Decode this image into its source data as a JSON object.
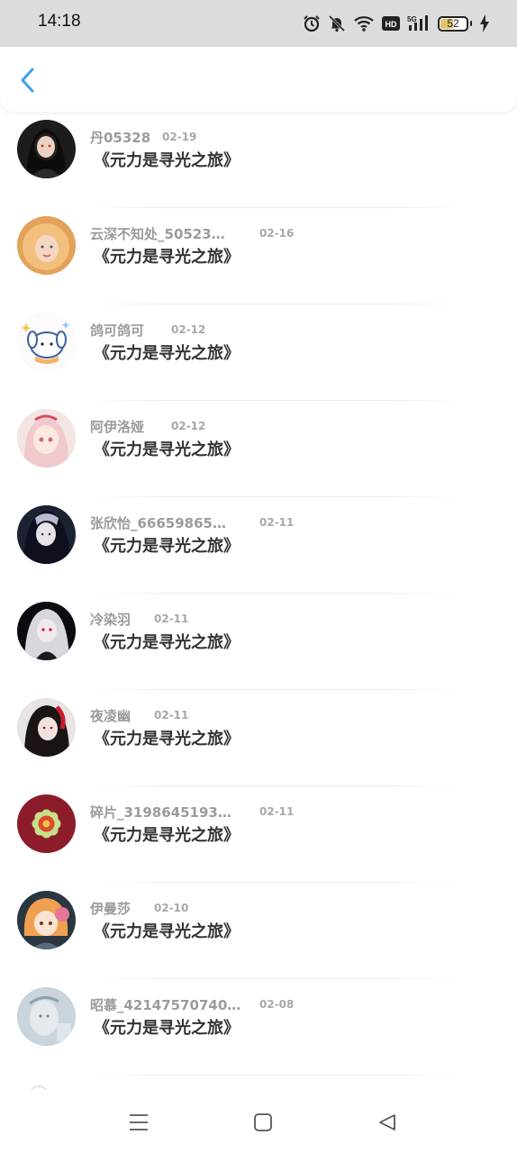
{
  "status_bar": {
    "time": "14:18",
    "battery": "52",
    "battery_level": 0.52,
    "icons": [
      "alarm-icon",
      "mute-icon",
      "wifi-icon",
      "hd-icon",
      "signal-5g-icon",
      "battery-icon",
      "charging-icon"
    ],
    "hd_label": "HD",
    "network_label": "5G"
  },
  "header": {
    "back_icon": "chevron-left-icon",
    "accent": "#3aa0e6"
  },
  "list": {
    "items": [
      {
        "name": "丹05328",
        "date": "02-19",
        "title": "《元力是寻光之旅》"
      },
      {
        "name": "云深不知处_50523…",
        "date": "02-16",
        "title": "《元力是寻光之旅》"
      },
      {
        "name": "鸽可鸽可",
        "date": "02-12",
        "title": "《元力是寻光之旅》"
      },
      {
        "name": "阿伊洛娅",
        "date": "02-12",
        "title": "《元力是寻光之旅》"
      },
      {
        "name": "张欣怡_66659865…",
        "date": "02-11",
        "title": "《元力是寻光之旅》"
      },
      {
        "name": "冷染羽",
        "date": "02-11",
        "title": "《元力是寻光之旅》"
      },
      {
        "name": "夜凌幽",
        "date": "02-11",
        "title": "《元力是寻光之旅》"
      },
      {
        "name": "碎片_3198645193…",
        "date": "02-11",
        "title": "《元力是寻光之旅》"
      },
      {
        "name": "伊曼莎",
        "date": "02-10",
        "title": "《元力是寻光之旅》"
      },
      {
        "name": "昭慕_42147570740…",
        "date": "02-08",
        "title": "《元力是寻光之旅》"
      }
    ]
  },
  "nav_bar": {
    "icons": [
      "menu-icon",
      "home-icon",
      "back-triangle-icon"
    ]
  }
}
